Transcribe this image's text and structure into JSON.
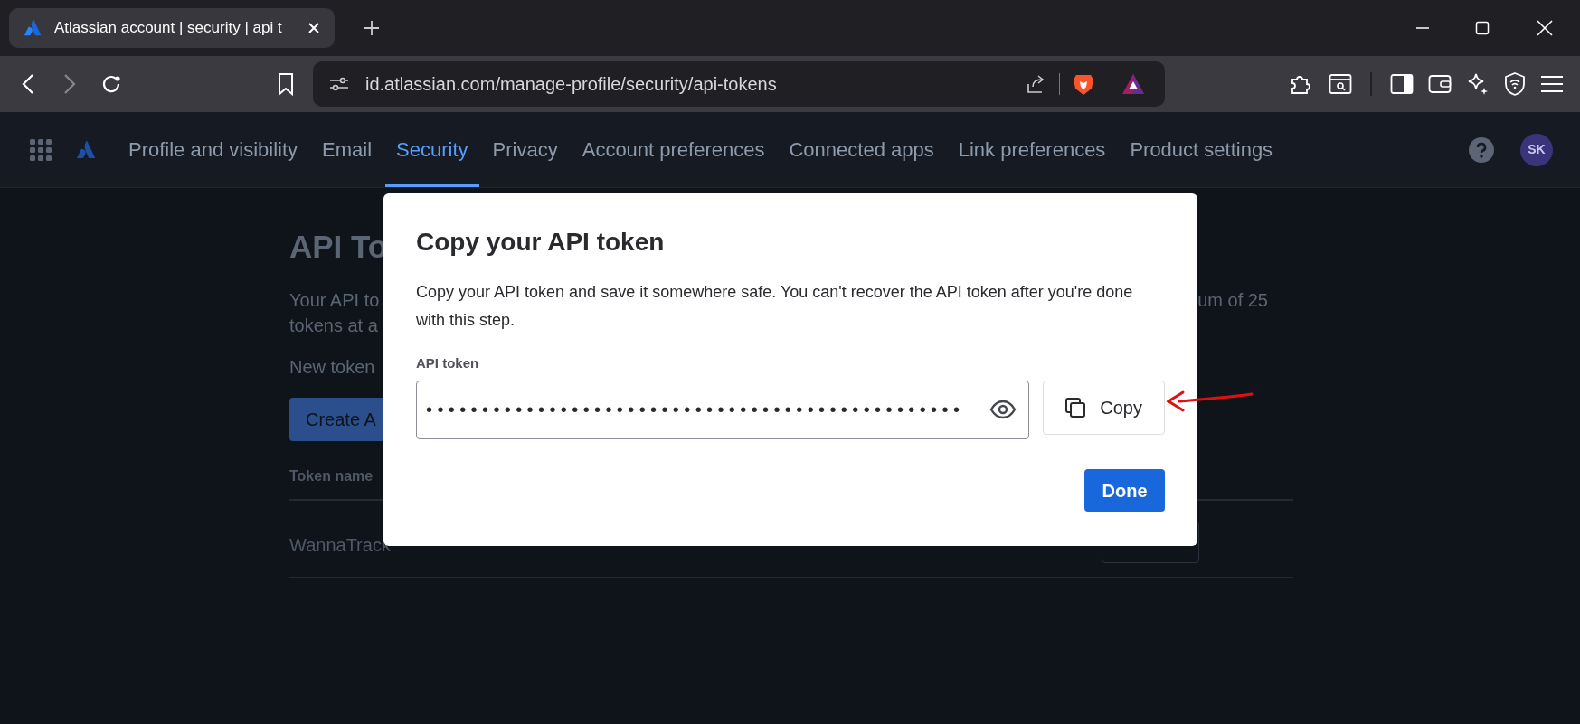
{
  "browser": {
    "tab_title": "Atlassian account | security | api t",
    "url": "id.atlassian.com/manage-profile/security/api-tokens"
  },
  "nav": {
    "items": [
      {
        "label": "Profile and visibility",
        "selected": false
      },
      {
        "label": "Email",
        "selected": false
      },
      {
        "label": "Security",
        "selected": true
      },
      {
        "label": "Privacy",
        "selected": false
      },
      {
        "label": "Account preferences",
        "selected": false
      },
      {
        "label": "Connected apps",
        "selected": false
      },
      {
        "label": "Link preferences",
        "selected": false
      },
      {
        "label": "Product settings",
        "selected": false
      }
    ],
    "avatar": "SK"
  },
  "page": {
    "heading": "API To",
    "intro_left": "Your API to",
    "intro_right": "um of 25",
    "intro_line_2": "tokens at a",
    "note": "New token",
    "create_button": "Create A",
    "table_header": "Token name",
    "rows": [
      {
        "name": "WannaTrack"
      }
    ]
  },
  "modal": {
    "title": "Copy your API token",
    "description": "Copy your API token and save it somewhere safe. You can't recover the API token after you're done with this step.",
    "field_label": "API token",
    "token": "••••••••••••••••••••••••••••••••••••••••••••••••",
    "copy_button": "Copy",
    "done_button": "Done"
  }
}
